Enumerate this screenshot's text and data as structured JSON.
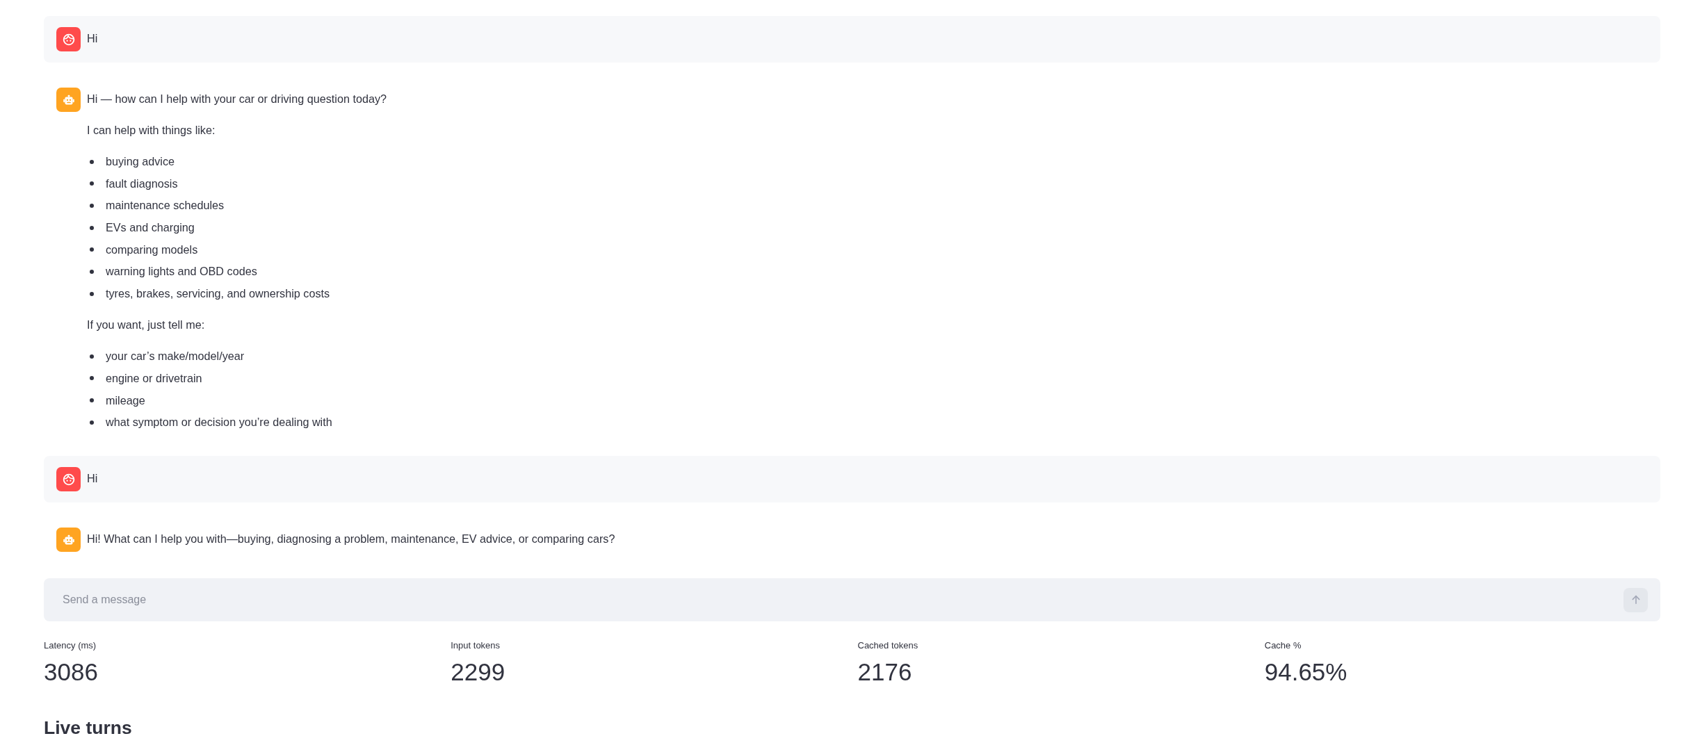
{
  "messages": [
    {
      "kind": "user",
      "content": [
        {
          "kind": "paragraph",
          "text": "Hi"
        }
      ]
    },
    {
      "kind": "assistant",
      "content": [
        {
          "kind": "paragraph",
          "text": "Hi — how can I help with your car or driving question today?"
        },
        {
          "kind": "paragraph",
          "text": "I can help with things like:"
        },
        {
          "kind": "list",
          "items": [
            "buying advice",
            "fault diagnosis",
            "maintenance schedules",
            "EVs and charging",
            "comparing models",
            "warning lights and OBD codes",
            "tyres, brakes, servicing, and ownership costs"
          ]
        },
        {
          "kind": "paragraph",
          "text": "If you want, just tell me:"
        },
        {
          "kind": "list",
          "items": [
            "your car’s make/model/year",
            "engine or drivetrain",
            "mileage",
            "what symptom or decision you’re dealing with"
          ]
        }
      ]
    },
    {
      "kind": "user",
      "content": [
        {
          "kind": "paragraph",
          "text": "Hi"
        }
      ]
    },
    {
      "kind": "assistant",
      "content": [
        {
          "kind": "paragraph",
          "text": "Hi! What can I help you with—buying, diagnosing a problem, maintenance, EV advice, or comparing cars?"
        }
      ]
    }
  ],
  "chat_input": {
    "placeholder": "Send a message",
    "send_button": {
      "disabled": true
    }
  },
  "metrics": [
    {
      "label": "Latency (ms)",
      "value": "3086"
    },
    {
      "label": "Input tokens",
      "value": "2299"
    },
    {
      "label": "Cached tokens",
      "value": "2176"
    },
    {
      "label": "Cache %",
      "value": "94.65%"
    }
  ],
  "heading": "Live turns"
}
